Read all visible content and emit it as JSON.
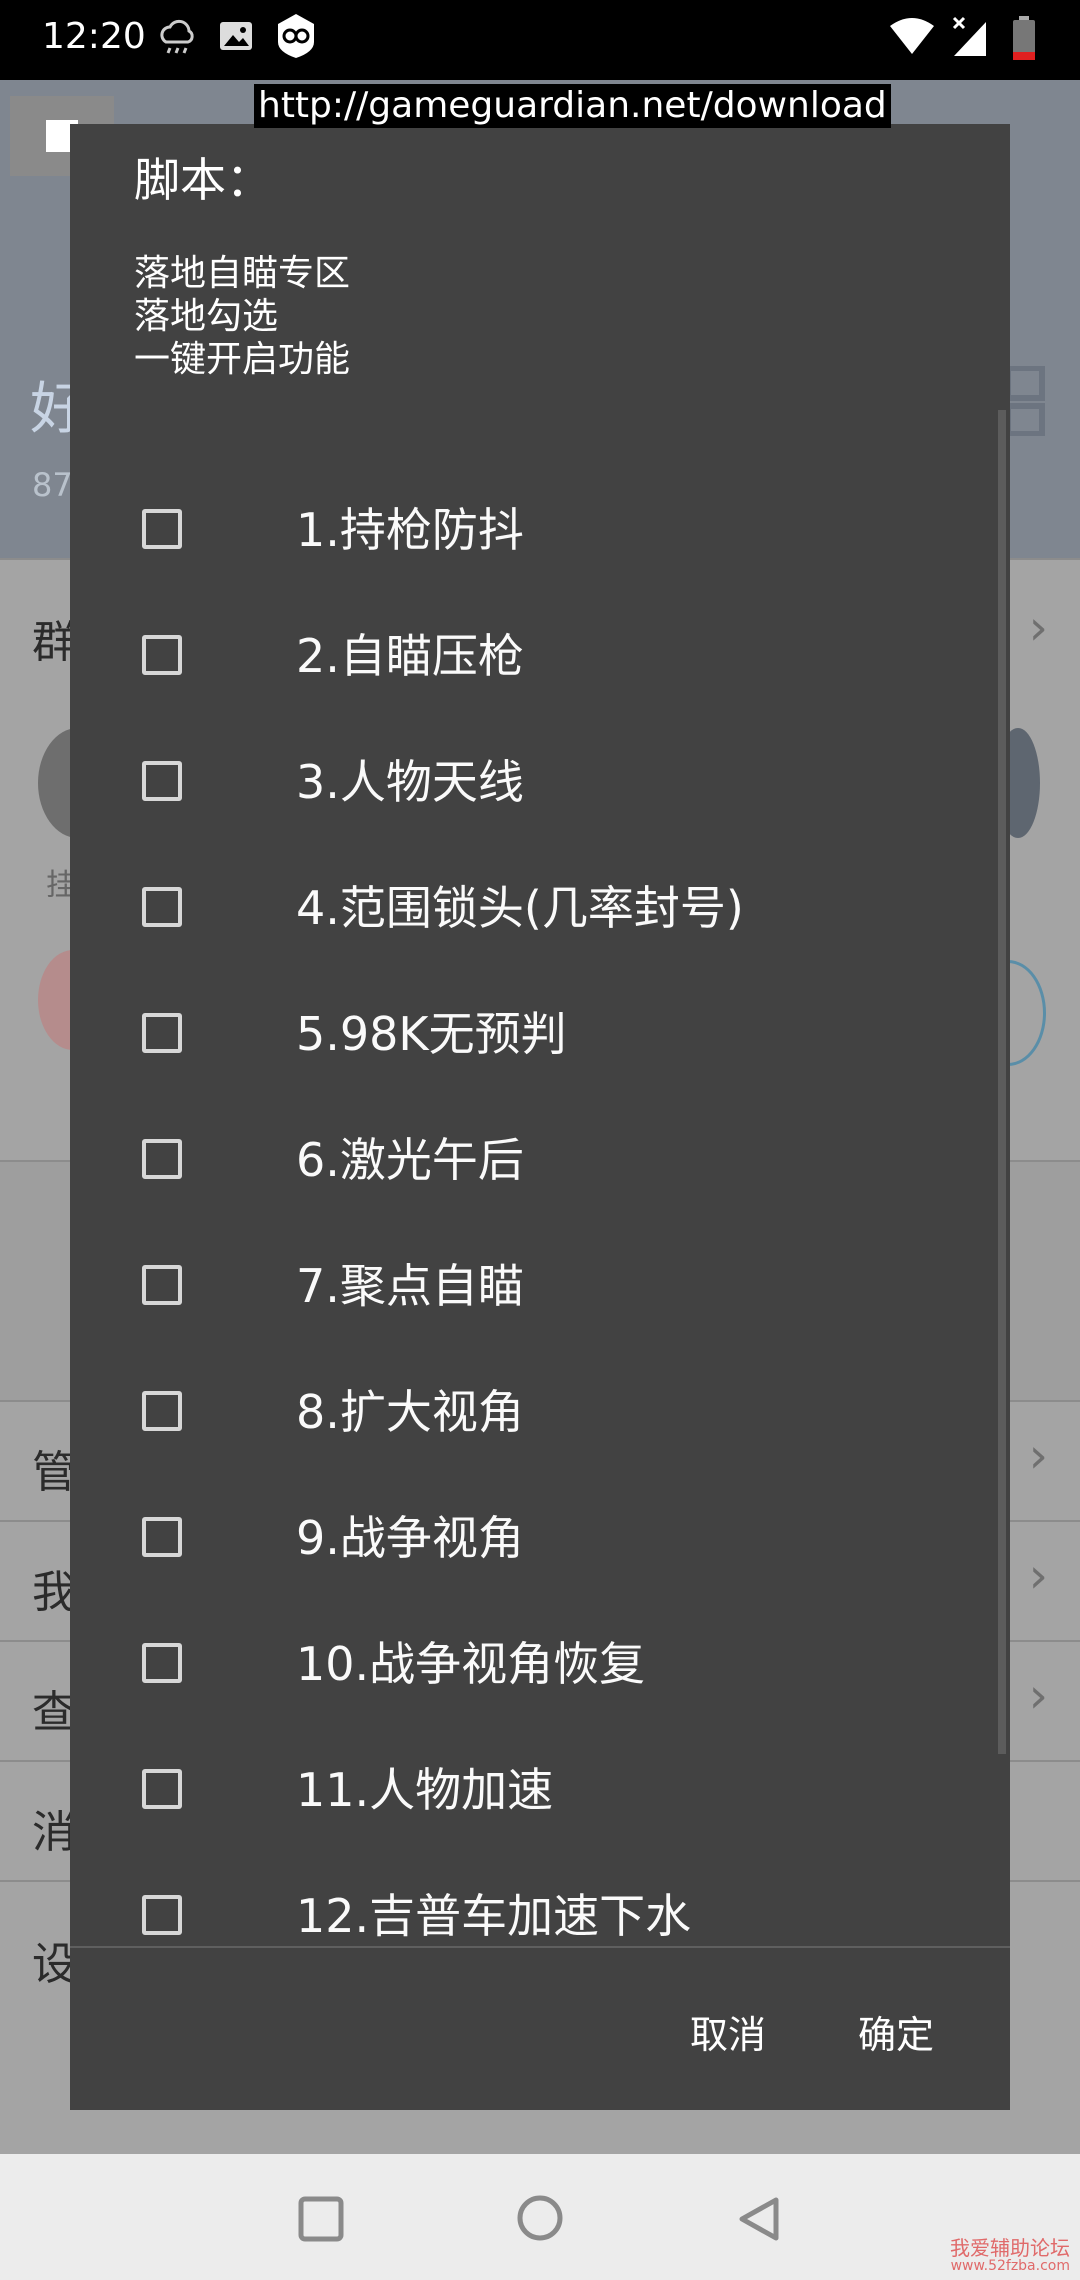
{
  "status_bar": {
    "time": "12:20"
  },
  "overlay_url": "http://gameguardian.net/download",
  "background_app": {
    "header_initial": "好",
    "header_count": "87",
    "section_title": "群",
    "caption": "挂",
    "rows": [
      "管",
      "我",
      "查",
      "消",
      "设"
    ]
  },
  "dialog": {
    "title": "脚本：",
    "message": "落地自瞄专区\n落地勾选\n一键开启功能",
    "options": [
      {
        "label": "1.持枪防抖",
        "checked": false
      },
      {
        "label": "2.自瞄压枪",
        "checked": false
      },
      {
        "label": "3.人物天线",
        "checked": false
      },
      {
        "label": "4.范围锁头(几率封号)",
        "checked": false
      },
      {
        "label": "5.98K无预判",
        "checked": false
      },
      {
        "label": "6.激光午后",
        "checked": false
      },
      {
        "label": "7.聚点自瞄",
        "checked": false
      },
      {
        "label": "8.扩大视角",
        "checked": false
      },
      {
        "label": "9.战争视角",
        "checked": false
      },
      {
        "label": "10.战争视角恢复",
        "checked": false
      },
      {
        "label": "11.人物加速",
        "checked": false
      },
      {
        "label": "12.吉普车加速下水",
        "checked": false
      }
    ],
    "cancel_label": "取消",
    "ok_label": "确定"
  },
  "watermark": {
    "line1": "我爱辅助论坛",
    "line2": "www.52fzba.com"
  }
}
